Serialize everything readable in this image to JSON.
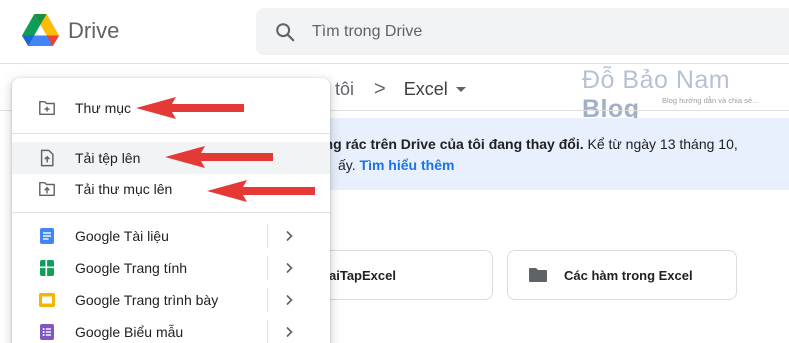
{
  "app": {
    "name": "Drive"
  },
  "search": {
    "placeholder": "Tìm trong Drive"
  },
  "breadcrumb": {
    "previous": "ủa tôi",
    "separator": ">",
    "current": "Excel"
  },
  "watermark": {
    "title_light": "Đỗ Bảo Nam ",
    "title_bold": "Blog",
    "tagline": "Blog hướng dẫn và chia sẻ..."
  },
  "banner": {
    "line1_bold": "ùng rác trên Drive của tôi đang thay đổi.",
    "line1_rest": " Kể từ ngày 13 tháng 10,",
    "line2_prefix": "ấy. ",
    "link": "Tìm hiểu thêm"
  },
  "folders": [
    {
      "name": "aiTapExcel"
    },
    {
      "name": "Các hàm trong Excel"
    }
  ],
  "menu": {
    "items": [
      {
        "label": "Thư mục",
        "icon": "new-folder-icon"
      },
      {
        "label": "Tải tệp lên",
        "icon": "file-upload-icon"
      },
      {
        "label": "Tải thư mục lên",
        "icon": "folder-upload-icon"
      },
      {
        "label": "Google Tài liệu",
        "icon": "google-docs-icon"
      },
      {
        "label": "Google Trang tính",
        "icon": "google-sheets-icon"
      },
      {
        "label": "Google Trang trình bày",
        "icon": "google-slides-icon"
      },
      {
        "label": "Google Biểu mẫu",
        "icon": "google-forms-icon"
      }
    ]
  },
  "colors": {
    "annotation_arrow": "#e53935",
    "docs": "#4285f4",
    "sheets": "#0f9d58",
    "slides": "#f4b400",
    "forms": "#7e57c2",
    "banner_bg": "#e8f0fe",
    "link": "#1a73e8"
  }
}
